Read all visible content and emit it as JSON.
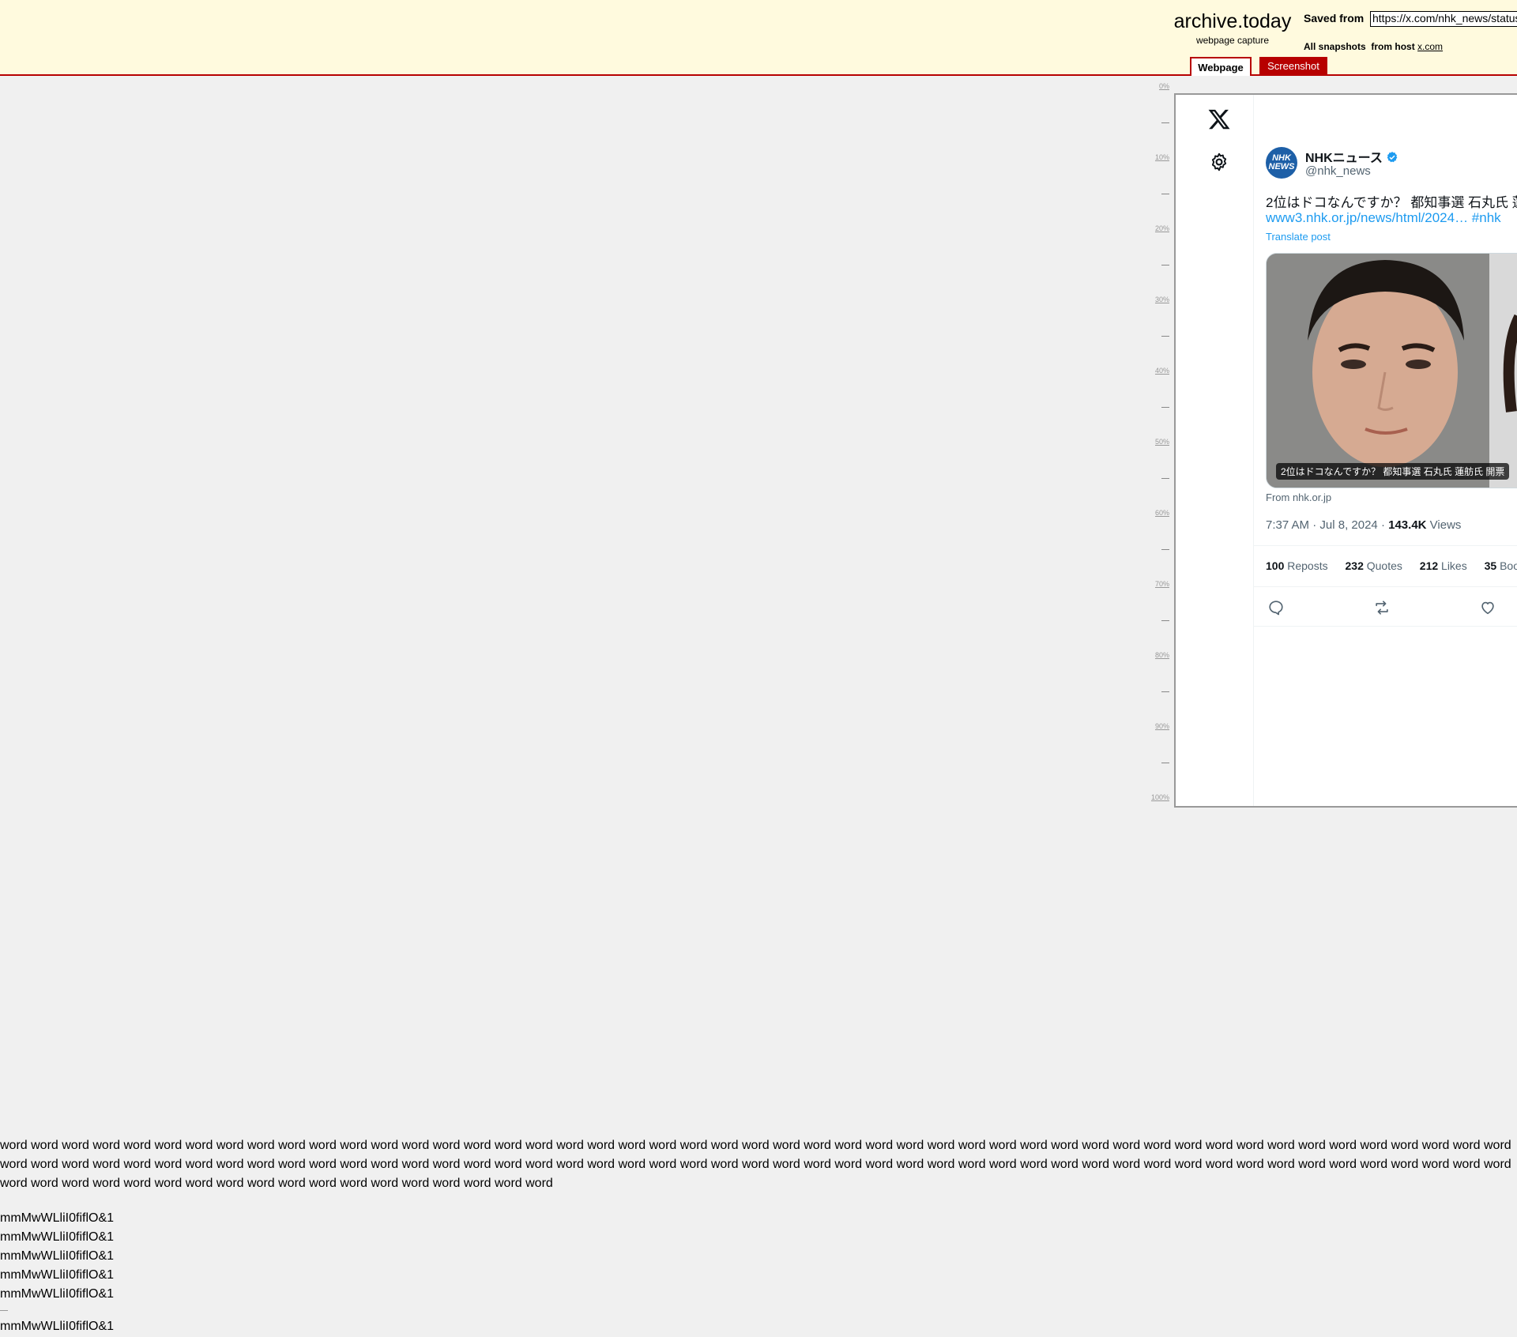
{
  "header": {
    "site_name": "archive.today",
    "site_tagline": "webpage capture",
    "saved_from_label": "Saved from",
    "saved_from_url": "https://x.com/nhk_news/status",
    "all_snapshots_label": "All snapshots",
    "from_host_label": "from host",
    "host": "x.com",
    "tabs": [
      {
        "label": "Webpage",
        "active": true
      },
      {
        "label": "Screenshot",
        "active": false
      }
    ]
  },
  "ruler": {
    "labels": [
      "0%",
      "10%",
      "20%",
      "30%",
      "40%",
      "50%",
      "60%",
      "70%",
      "80%",
      "90%",
      "100%"
    ]
  },
  "tweet": {
    "author_name": "NHKニュース",
    "author_handle": "@nhk_news",
    "avatar_text": [
      "NHK",
      "NEWS"
    ],
    "text": "2位はドコなんですか？ 都知事選 石丸氏 蓮",
    "link": "www3.nhk.or.jp/news/html/2024… #nhk",
    "translate_label": "Translate post",
    "card_caption": "2位はドコなんですか？ 都知事選 石丸氏 蓮舫氏 開票",
    "card_source": "From nhk.or.jp",
    "time": "7:37 AM",
    "date": "Jul 8, 2024",
    "views_count": "143.4K",
    "views_label": "Views",
    "stats": {
      "reposts_count": "100",
      "reposts_label": "Reposts",
      "quotes_count": "232",
      "quotes_label": "Quotes",
      "likes_count": "212",
      "likes_label": "Likes",
      "bookmarks_count": "35",
      "bookmarks_label": "Boo"
    }
  },
  "colors": {
    "header_bg": "#fffade",
    "accent_red": "#b70000",
    "twitter_blue": "#1d9bf0"
  },
  "icons": [
    "x-logo-icon",
    "gear-icon",
    "verified-icon",
    "reply-icon",
    "repost-icon",
    "like-icon"
  ],
  "filler": {
    "paragraph": "word word word word word word word word word word word word word word word word word word word word word word word word word word word word word word word word word word word word word word word word word word word word word word word word word word word word word word word word word word word word word word word word word word word word word word word word word word word word word word word word word word word word word word word word word word word word word word word word word word word word word word word word word word word word word word word word word word word word",
    "lines": [
      "mmMwWLliI0fiflO&1",
      "mmMwWLliI0fiflO&1",
      "mmMwWLliI0fiflO&1",
      "mmMwWLliI0fiflO&1",
      "mmMwWLliI0fiflO&1"
    ],
    "after_dash_line": "mmMwWLliI0fiflO&1"
  }
}
